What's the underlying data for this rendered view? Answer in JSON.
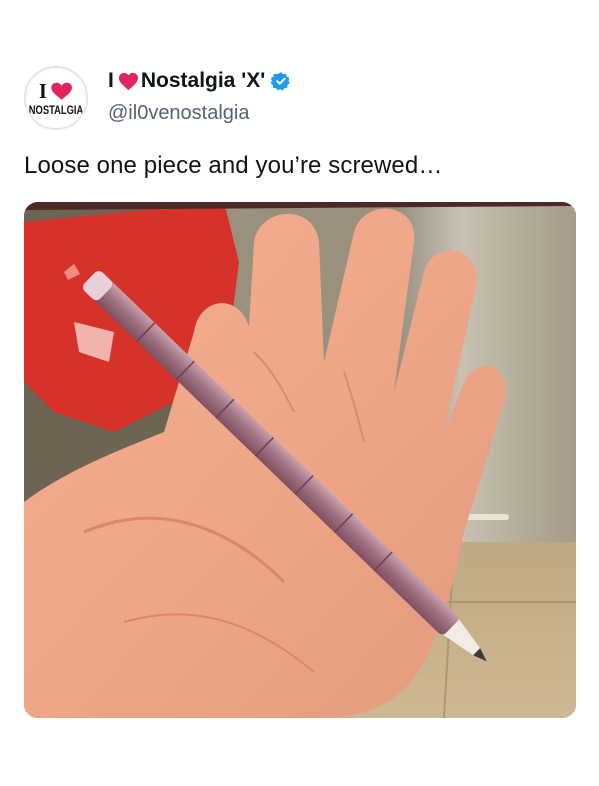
{
  "author": {
    "avatar_icon": "i-love-nostalgia-logo-icon",
    "avatar_text_top": "I",
    "avatar_text_bottom": "NOSTALGIA",
    "name_prefix": "I",
    "name_heart_icon": "red-heart-icon",
    "name_suffix": "Nostalgia 'X'",
    "verified_icon": "verified-badge-icon",
    "handle": "@il0venostalgia"
  },
  "tweet": {
    "text": "Loose one piece and you’re screwed…"
  },
  "media": {
    "icon": "hand-holding-stacking-pencil-photo"
  },
  "colors": {
    "heart": "#e0245e",
    "verified": "#1d9bf0",
    "handle": "#536471",
    "text": "#0f1419"
  }
}
